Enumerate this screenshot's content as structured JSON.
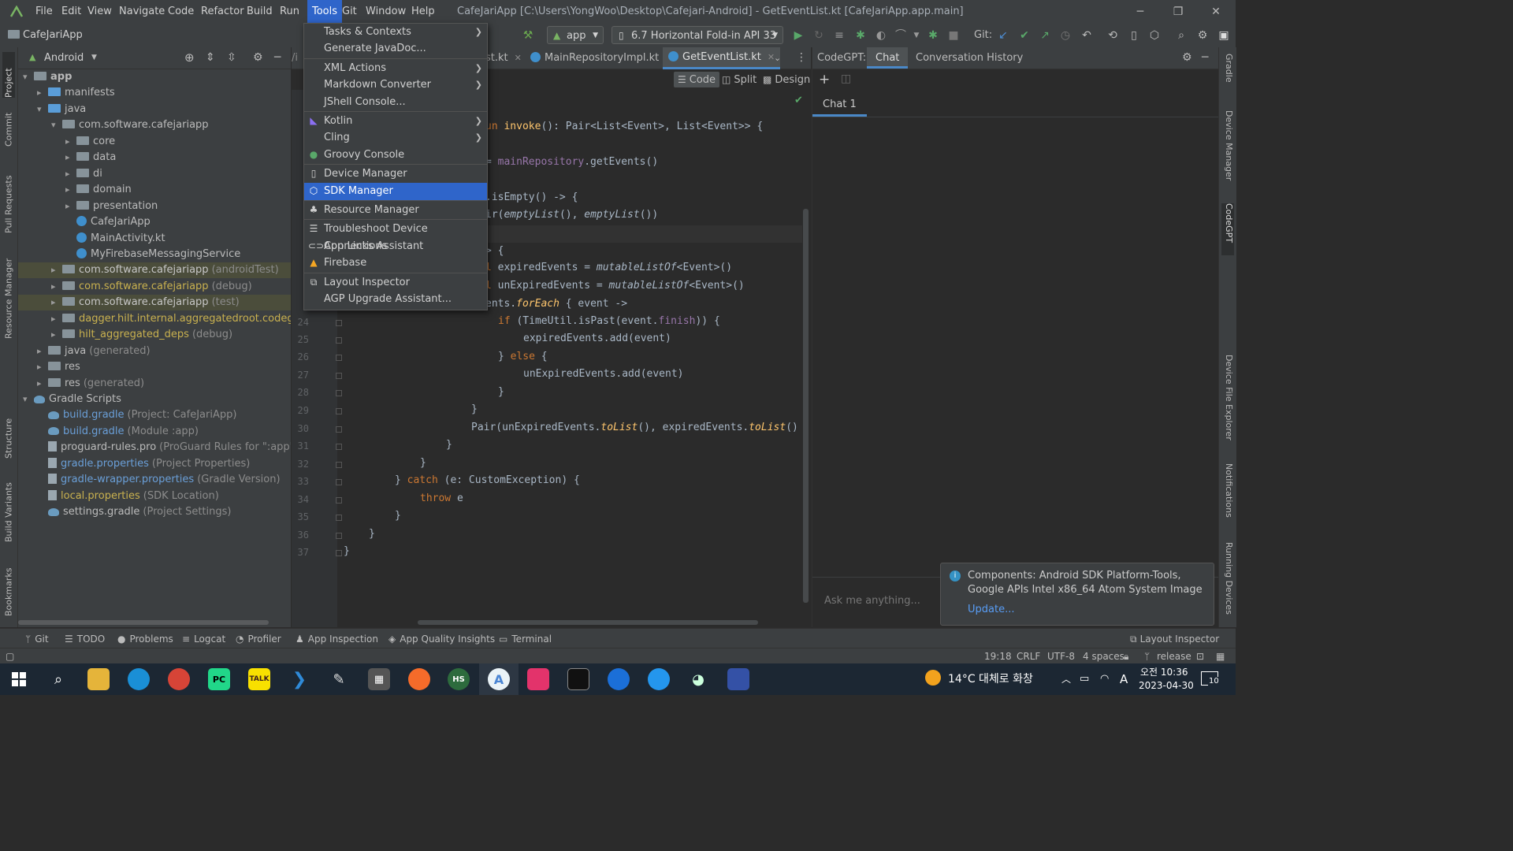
{
  "titlebar": {
    "menus": [
      "File",
      "Edit",
      "View",
      "Navigate",
      "Code",
      "Refactor",
      "Build",
      "Run",
      "Tools",
      "Git",
      "Window",
      "Help"
    ],
    "active_menu": "Tools",
    "title": "CafeJariApp [C:\\Users\\YongWoo\\Desktop\\Cafejari-Android] - GetEventList.kt [CafeJariApp.app.main]"
  },
  "toolbar": {
    "project_name": "CafeJariApp",
    "run_config": "app",
    "device": "6.7  Horizontal Fold-in API 33",
    "git_label": "Git:"
  },
  "project_panel": {
    "view_selector": "Android",
    "tree": [
      {
        "label": "app",
        "extra": "",
        "depth": 0,
        "arrow": "▾",
        "icon": "folder",
        "bold": true
      },
      {
        "label": "manifests",
        "extra": "",
        "depth": 1,
        "arrow": "▸",
        "icon": "folder-blue"
      },
      {
        "label": "java",
        "extra": "",
        "depth": 1,
        "arrow": "▾",
        "icon": "folder-blue"
      },
      {
        "label": "com.software.cafejariapp",
        "extra": "",
        "depth": 2,
        "arrow": "▾",
        "icon": "folder"
      },
      {
        "label": "core",
        "extra": "",
        "depth": 3,
        "arrow": "▸",
        "icon": "folder"
      },
      {
        "label": "data",
        "extra": "",
        "depth": 3,
        "arrow": "▸",
        "icon": "folder"
      },
      {
        "label": "di",
        "extra": "",
        "depth": 3,
        "arrow": "▸",
        "icon": "folder"
      },
      {
        "label": "domain",
        "extra": "",
        "depth": 3,
        "arrow": "▸",
        "icon": "folder"
      },
      {
        "label": "presentation",
        "extra": "",
        "depth": 3,
        "arrow": "▸",
        "icon": "folder"
      },
      {
        "label": "CafeJariApp",
        "extra": "",
        "depth": 3,
        "arrow": "",
        "icon": "kt"
      },
      {
        "label": "MainActivity.kt",
        "extra": "",
        "depth": 3,
        "arrow": "",
        "icon": "kt"
      },
      {
        "label": "MyFirebaseMessagingService",
        "extra": "",
        "depth": 3,
        "arrow": "",
        "icon": "kt"
      },
      {
        "label": "com.software.cafejariapp",
        "extra": "(androidTest)",
        "depth": 2,
        "arrow": "▸",
        "icon": "folder",
        "hl": true
      },
      {
        "label": "com.software.cafejariapp",
        "extra": "(debug)",
        "depth": 2,
        "arrow": "▸",
        "icon": "folder",
        "yellow": true
      },
      {
        "label": "com.software.cafejariapp",
        "extra": "(test)",
        "depth": 2,
        "arrow": "▸",
        "icon": "folder",
        "hl": true
      },
      {
        "label": "dagger.hilt.internal.aggregatedroot.codegen",
        "extra": "(de",
        "depth": 2,
        "arrow": "▸",
        "icon": "folder",
        "yellow": true
      },
      {
        "label": "hilt_aggregated_deps",
        "extra": "(debug)",
        "depth": 2,
        "arrow": "▸",
        "icon": "folder",
        "yellow": true
      },
      {
        "label": "java",
        "extra": "(generated)",
        "depth": 1,
        "arrow": "▸",
        "icon": "folder"
      },
      {
        "label": "res",
        "extra": "",
        "depth": 1,
        "arrow": "▸",
        "icon": "folder"
      },
      {
        "label": "res",
        "extra": "(generated)",
        "depth": 1,
        "arrow": "▸",
        "icon": "folder"
      },
      {
        "label": "Gradle Scripts",
        "extra": "",
        "depth": 0,
        "arrow": "▾",
        "icon": "gradle"
      },
      {
        "label": "build.gradle",
        "extra": "(Project: CafeJariApp)",
        "depth": 1,
        "arrow": "",
        "icon": "gradle",
        "link": true
      },
      {
        "label": "build.gradle",
        "extra": "(Module :app)",
        "depth": 1,
        "arrow": "",
        "icon": "gradle",
        "link": true
      },
      {
        "label": "proguard-rules.pro",
        "extra": "(ProGuard Rules for \":app\")",
        "depth": 1,
        "arrow": "",
        "icon": "file"
      },
      {
        "label": "gradle.properties",
        "extra": "(Project Properties)",
        "depth": 1,
        "arrow": "",
        "icon": "file",
        "link": true
      },
      {
        "label": "gradle-wrapper.properties",
        "extra": "(Gradle Version)",
        "depth": 1,
        "arrow": "",
        "icon": "file",
        "link": true
      },
      {
        "label": "local.properties",
        "extra": "(SDK Location)",
        "depth": 1,
        "arrow": "",
        "icon": "file",
        "yellow": true
      },
      {
        "label": "settings.gradle",
        "extra": "(Project Settings)",
        "depth": 1,
        "arrow": "",
        "icon": "gradle"
      }
    ]
  },
  "editor": {
    "tabs": [
      "st.kt",
      "MainRepositoryImpl.kt",
      "GetEventList.kt"
    ],
    "active_tab": "GetEventList.kt",
    "view_modes": [
      "Code",
      "Split",
      "Design"
    ],
    "line_numbers": [
      "24",
      "25",
      "26",
      "27",
      "28",
      "29",
      "30",
      "31",
      "32",
      "33",
      "34",
      "35",
      "36",
      "37"
    ]
  },
  "tools_menu": {
    "items": [
      {
        "label": "Tasks & Contexts",
        "submenu": true,
        "icon": ""
      },
      {
        "label": "Generate JavaDoc...",
        "submenu": false,
        "icon": ""
      },
      {
        "label": "XML Actions",
        "submenu": true,
        "icon": ""
      },
      {
        "label": "Markdown Converter",
        "submenu": true,
        "icon": ""
      },
      {
        "label": "JShell Console...",
        "submenu": false,
        "icon": ""
      },
      {
        "label": "Kotlin",
        "submenu": true,
        "icon": "kotlin-icon"
      },
      {
        "label": "Cling",
        "submenu": true,
        "icon": ""
      },
      {
        "label": "Groovy Console",
        "submenu": false,
        "icon": "groovy-icon"
      },
      {
        "label": "Device Manager",
        "submenu": false,
        "icon": "device-icon"
      },
      {
        "label": "SDK Manager",
        "submenu": false,
        "icon": "sdk-icon",
        "selected": true
      },
      {
        "label": "Resource Manager",
        "submenu": false,
        "icon": "resource-icon"
      },
      {
        "label": "Troubleshoot Device Connections",
        "submenu": false,
        "icon": "list-icon"
      },
      {
        "label": "App Links Assistant",
        "submenu": false,
        "icon": "link-icon"
      },
      {
        "label": "Firebase",
        "submenu": false,
        "icon": "firebase-icon"
      },
      {
        "label": "Layout Inspector",
        "submenu": false,
        "icon": "inspector-icon"
      },
      {
        "label": "AGP Upgrade Assistant...",
        "submenu": false,
        "icon": ""
      }
    ]
  },
  "codegpt": {
    "label": "CodeGPT:",
    "tabs": [
      "Chat",
      "Conversation History"
    ],
    "chat_tab": "Chat 1",
    "input_placeholder": "Ask me anything..."
  },
  "notification": {
    "line1": "Components: Android SDK Platform-Tools,",
    "line2": "Google APIs Intel x86_64 Atom System Image",
    "action": "Update..."
  },
  "left_stripe": [
    "Project",
    "Commit",
    "Pull Requests",
    "Resource Manager",
    "Structure",
    "Build Variants",
    "Bookmarks"
  ],
  "right_stripe": [
    "Gradle",
    "Device Manager",
    "CodeGPT",
    "Device File Explorer",
    "Notifications",
    "Running Devices"
  ],
  "bottom_tools": [
    "Git",
    "TODO",
    "Problems",
    "Logcat",
    "Profiler",
    "App Inspection",
    "App Quality Insights",
    "Terminal"
  ],
  "bottom_right_tool": "Layout Inspector",
  "status": {
    "position": "19:18",
    "line_sep": "CRLF",
    "encoding": "UTF-8",
    "indent": "4 spaces",
    "branch": "release"
  },
  "taskbar": {
    "weather": "14°C  대체로 화창",
    "ime": "A",
    "time": "오전 10:36",
    "date": "2023-04-30",
    "notif_count": "10"
  }
}
